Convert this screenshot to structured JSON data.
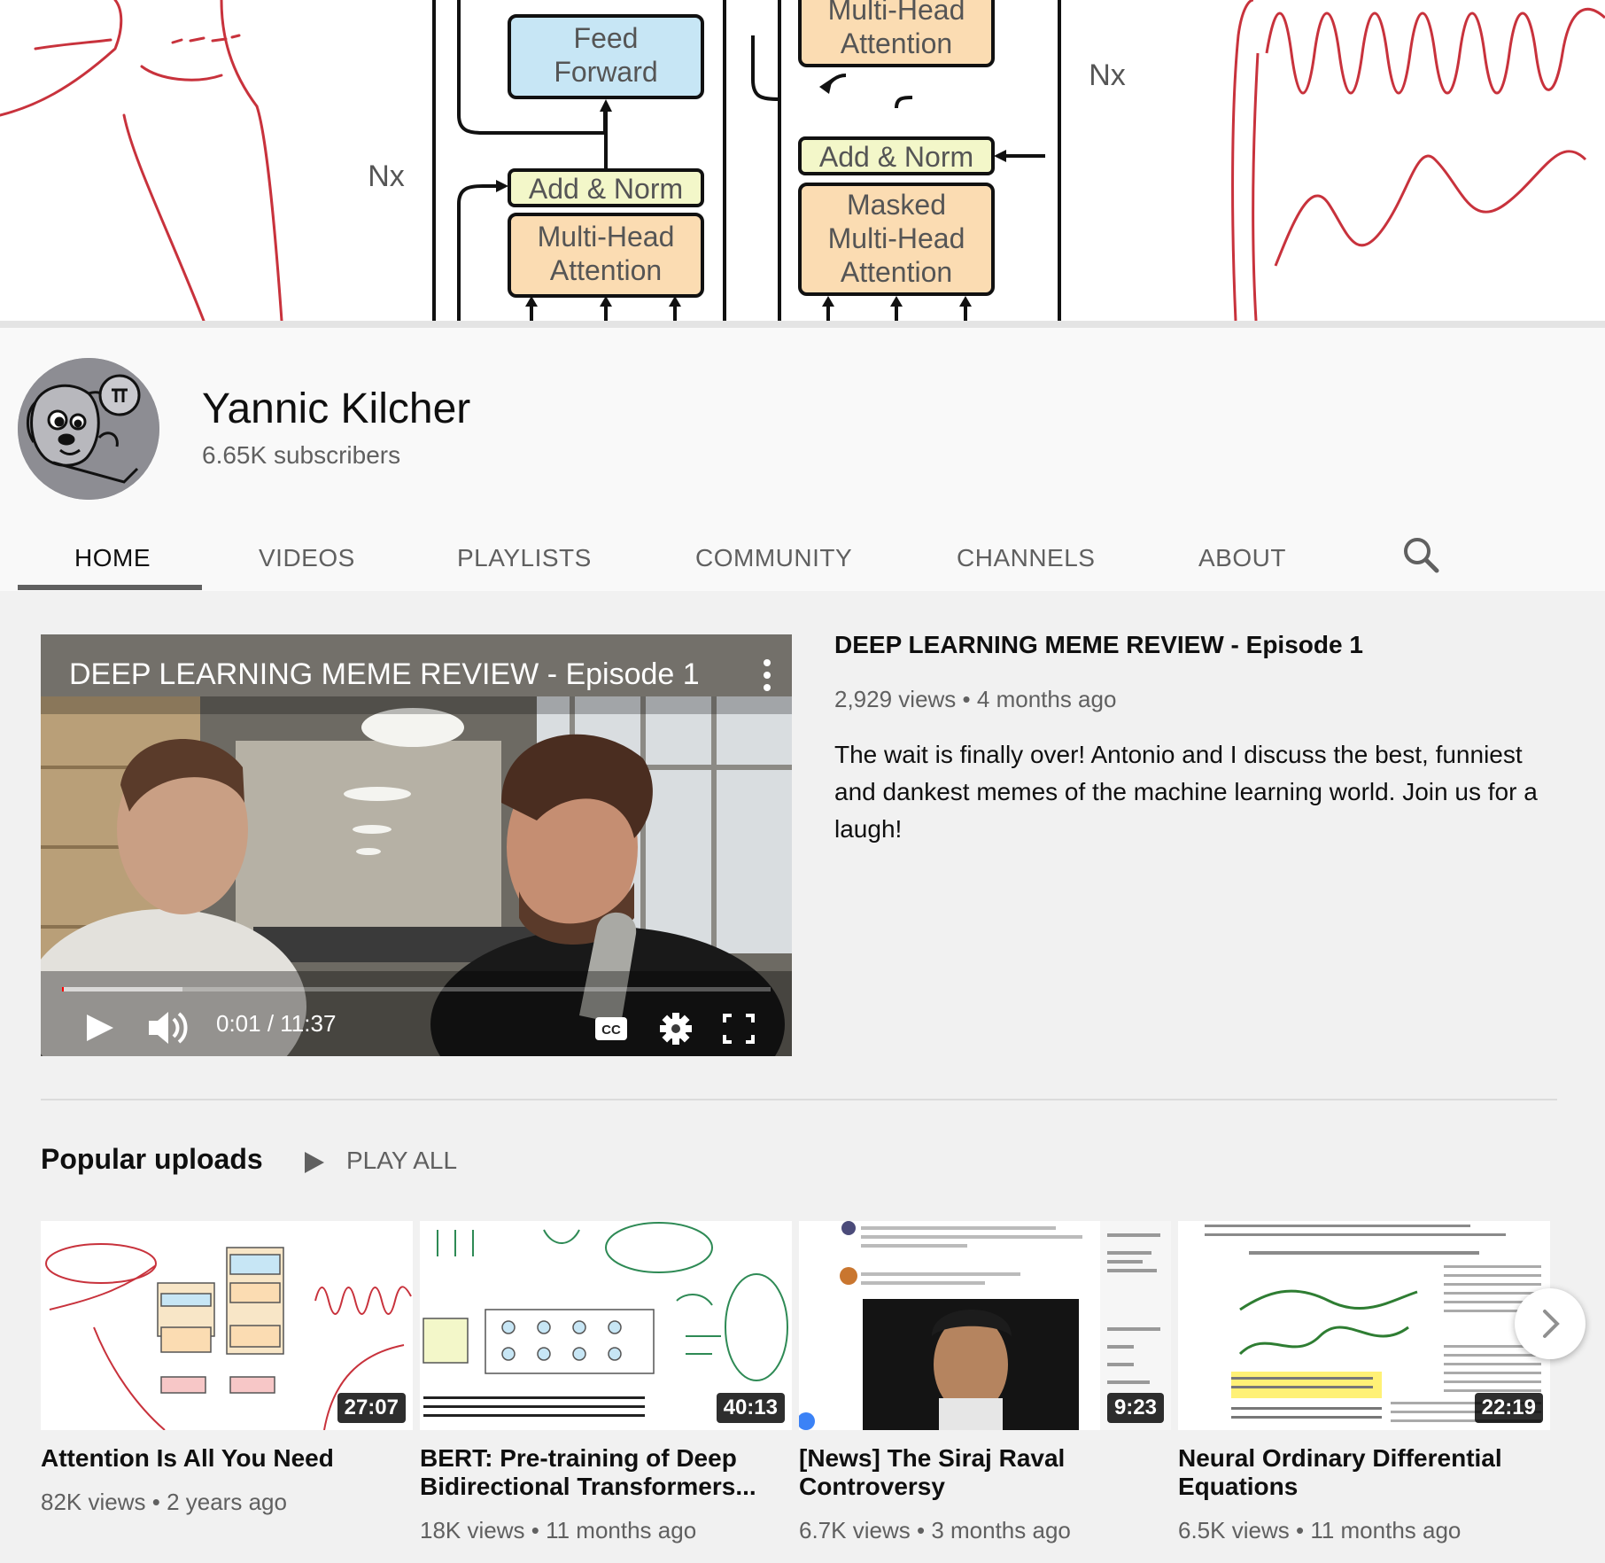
{
  "banner": {
    "label_nx_left": "Nx",
    "label_nx_right": "Nx",
    "blocks": {
      "feed_forward": "Feed Forward",
      "add_norm_left": "Add & Norm",
      "mha_left": "Multi-Head Attention",
      "mha_right_top": "Multi-Head Attention",
      "add_norm_right": "Add & Norm",
      "masked_mha": "Masked Multi-Head Attention"
    }
  },
  "channel": {
    "name": "Yannic Kilcher",
    "subscribers": "6.65K subscribers"
  },
  "tabs": [
    {
      "label": "HOME",
      "active": true
    },
    {
      "label": "VIDEOS",
      "active": false
    },
    {
      "label": "PLAYLISTS",
      "active": false
    },
    {
      "label": "COMMUNITY",
      "active": false
    },
    {
      "label": "CHANNELS",
      "active": false
    },
    {
      "label": "ABOUT",
      "active": false
    }
  ],
  "featured": {
    "player_title": "DEEP LEARNING MEME REVIEW - Episode 1",
    "time": "0:01 / 11:37",
    "progress_fraction": 0.002,
    "buffer_fraction": 0.17,
    "title": "DEEP LEARNING MEME REVIEW - Episode 1",
    "views": "2,929 views",
    "age": "4 months ago",
    "separator": "•",
    "description": "The wait is finally over! Antonio and I discuss the best, funniest and dankest memes of the machine learning world. Join us for a laugh!"
  },
  "popular": {
    "title": "Popular uploads",
    "play_all": "PLAY ALL",
    "videos": [
      {
        "title": "Attention Is All You Need",
        "views": "82K views",
        "age": "2 years ago",
        "duration": "27:07"
      },
      {
        "title": "BERT: Pre-training of Deep Bidirectional Transformers...",
        "views": "18K views",
        "age": "11 months ago",
        "duration": "40:13"
      },
      {
        "title": "[News] The Siraj Raval Controversy",
        "views": "6.7K views",
        "age": "3 months ago",
        "duration": "9:23"
      },
      {
        "title": "Neural Ordinary Differential Equations",
        "views": "6.5K views",
        "age": "11 months ago",
        "duration": "22:19"
      }
    ]
  },
  "colors": {
    "accent": "#ff0000",
    "text_primary": "#0f0f0f",
    "text_secondary": "#606060",
    "banner_red": "#c8323c",
    "block_blue": "#c7e6f5",
    "block_orange": "#fbdcb2",
    "block_yellow": "#f3f7c9"
  },
  "icons": {
    "search": "search-icon",
    "play": "play-icon",
    "volume": "volume-icon",
    "cc": "closed-captions-icon",
    "settings": "gear-icon",
    "fullscreen": "fullscreen-icon",
    "more": "more-vert-icon",
    "next": "chevron-right-icon"
  }
}
